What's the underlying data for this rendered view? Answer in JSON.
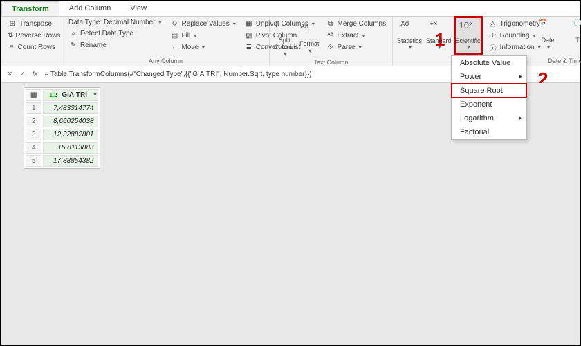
{
  "tabs": {
    "transform": "Transform",
    "add_column": "Add Column",
    "view": "View"
  },
  "ribbon": {
    "g_table": {
      "transpose": "Transpose",
      "reverse": "Reverse Rows",
      "count": "Count Rows"
    },
    "g_anycol": {
      "label": "Any Column",
      "datatype_lbl": "Data Type: Decimal Number",
      "detect": "Detect Data Type",
      "rename": "Rename",
      "replace": "Replace Values",
      "fill": "Fill",
      "move": "Move",
      "unpivot": "Unpivot Columns",
      "pivot": "Pivot Column",
      "convert": "Convert to List"
    },
    "g_textcol": {
      "label": "Text Column",
      "split": "Split\nColumn",
      "format": "Format",
      "merge": "Merge Columns",
      "extract": "Extract",
      "parse": "Parse"
    },
    "g_number": {
      "label": "Nu",
      "stats": "Statistics",
      "standard": "Standard",
      "scientific": "Scientific",
      "trig": "Trigonometry",
      "rounding": "Rounding",
      "info": "Information"
    },
    "g_datetime": {
      "label": "Date & Time",
      "date": "Date",
      "time": "Time"
    }
  },
  "fbar": {
    "formula": "= Table.TransformColumns(#\"Changed Type\",{{\"GIÁ TRỊ\", Number.Sqrt, type number}})"
  },
  "grid": {
    "col_type": "1.2",
    "col_name": "GIÁ TRỊ",
    "rows": [
      "7,483314774",
      "8,660254038",
      "12,32882801",
      "15,8113883",
      "17,88854382"
    ]
  },
  "menu": {
    "absolute": "Absolute Value",
    "power": "Power",
    "sqrt": "Square Root",
    "exponent": "Exponent",
    "log": "Logarithm",
    "factorial": "Factorial"
  },
  "annot": {
    "one": "1",
    "two": "2"
  }
}
